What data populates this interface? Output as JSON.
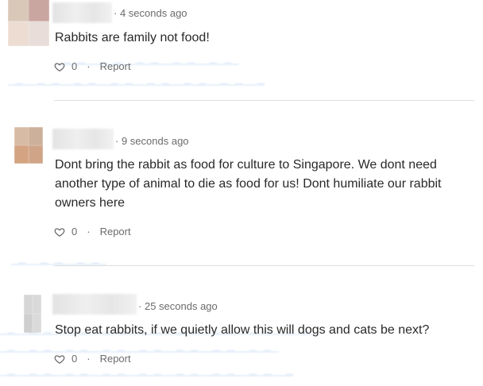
{
  "comments": [
    {
      "timestamp": "4 seconds ago",
      "text": "Rabbits are family not food!",
      "likes": "0",
      "report_label": "Report",
      "avatar_colors": [
        "#d9c8b8",
        "#c9a6a0",
        "#ecdcd2",
        "#e8ddd8"
      ]
    },
    {
      "timestamp": "9 seconds ago",
      "text": "Dont bring the rabbit as food for culture to Singapore. We dont need another type of animal to die as food for us! Dont humiliate our rabbit owners here",
      "likes": "0",
      "report_label": "Report",
      "avatar_colors": [
        "#d8bba5",
        "#cdb09b",
        "#d4a381",
        "#d0a587"
      ]
    },
    {
      "timestamp": "25 seconds ago",
      "text": "Stop eat rabbits, if we quietly allow this will dogs and cats be next?",
      "likes": "0",
      "report_label": "Report",
      "avatar_colors": [
        "#d6d6d6",
        "#d9d9d9",
        "#cfcfcf",
        "#dadada"
      ]
    }
  ],
  "separator": "·"
}
